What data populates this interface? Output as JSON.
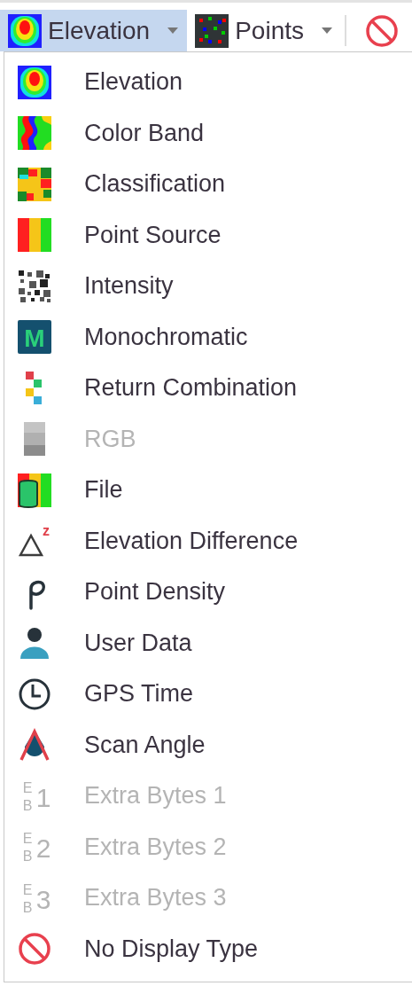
{
  "toolbar": {
    "buttons": [
      {
        "label": "Elevation",
        "kind": "elevation",
        "active": true,
        "dropdown": true
      },
      {
        "label": "Points",
        "kind": "points",
        "active": false,
        "dropdown": true
      },
      {
        "kind": "none",
        "active": false,
        "dropdown": false
      }
    ]
  },
  "menu": {
    "items": [
      {
        "label": "Elevation",
        "kind": "elevation",
        "disabled": false
      },
      {
        "label": "Color Band",
        "kind": "colorband",
        "disabled": false
      },
      {
        "label": "Classification",
        "kind": "classification",
        "disabled": false
      },
      {
        "label": "Point Source",
        "kind": "pointsource",
        "disabled": false
      },
      {
        "label": "Intensity",
        "kind": "intensity",
        "disabled": false
      },
      {
        "label": "Monochromatic",
        "kind": "mono",
        "icon_text": "M",
        "disabled": false
      },
      {
        "label": "Return Combination",
        "kind": "return",
        "disabled": false
      },
      {
        "label": "RGB",
        "kind": "rgb",
        "disabled": true
      },
      {
        "label": "File",
        "kind": "file",
        "disabled": false
      },
      {
        "label": "Elevation Difference",
        "kind": "elevdiff",
        "icon_text": "z",
        "disabled": false
      },
      {
        "label": "Point Density",
        "kind": "density",
        "disabled": false
      },
      {
        "label": "User Data",
        "kind": "user",
        "disabled": false
      },
      {
        "label": "GPS Time",
        "kind": "gps",
        "disabled": false
      },
      {
        "label": "Scan Angle",
        "kind": "scan",
        "disabled": false
      },
      {
        "label": "Extra Bytes 1",
        "kind": "extrabytes",
        "icon_text": "EB1",
        "disabled": true
      },
      {
        "label": "Extra Bytes 2",
        "kind": "extrabytes",
        "icon_text": "EB2",
        "disabled": true
      },
      {
        "label": "Extra Bytes 3",
        "kind": "extrabytes",
        "icon_text": "EB3",
        "disabled": true
      },
      {
        "label": "No Display Type",
        "kind": "none",
        "disabled": false
      }
    ]
  }
}
